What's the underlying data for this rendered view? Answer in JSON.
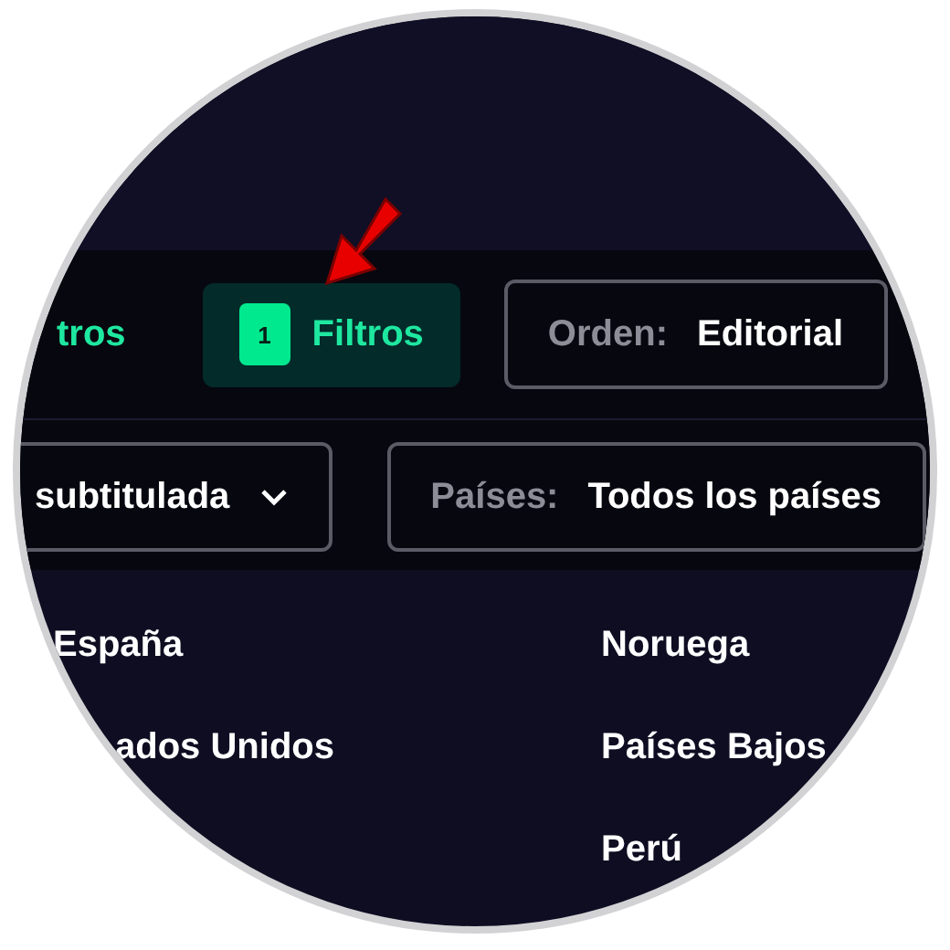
{
  "toolbar": {
    "link": "tros",
    "filter_button": {
      "count": "1",
      "label": "Filtros"
    },
    "sort": {
      "label": "Orden:",
      "value": "Editorial"
    }
  },
  "language": {
    "value": "subtitulada"
  },
  "countries_filter": {
    "label": "Países:",
    "value": "Todos los países"
  },
  "countries_left": [
    "España",
    "ados Unidos"
  ],
  "countries_right": [
    "Noruega",
    "Países Bajos",
    "Perú"
  ]
}
